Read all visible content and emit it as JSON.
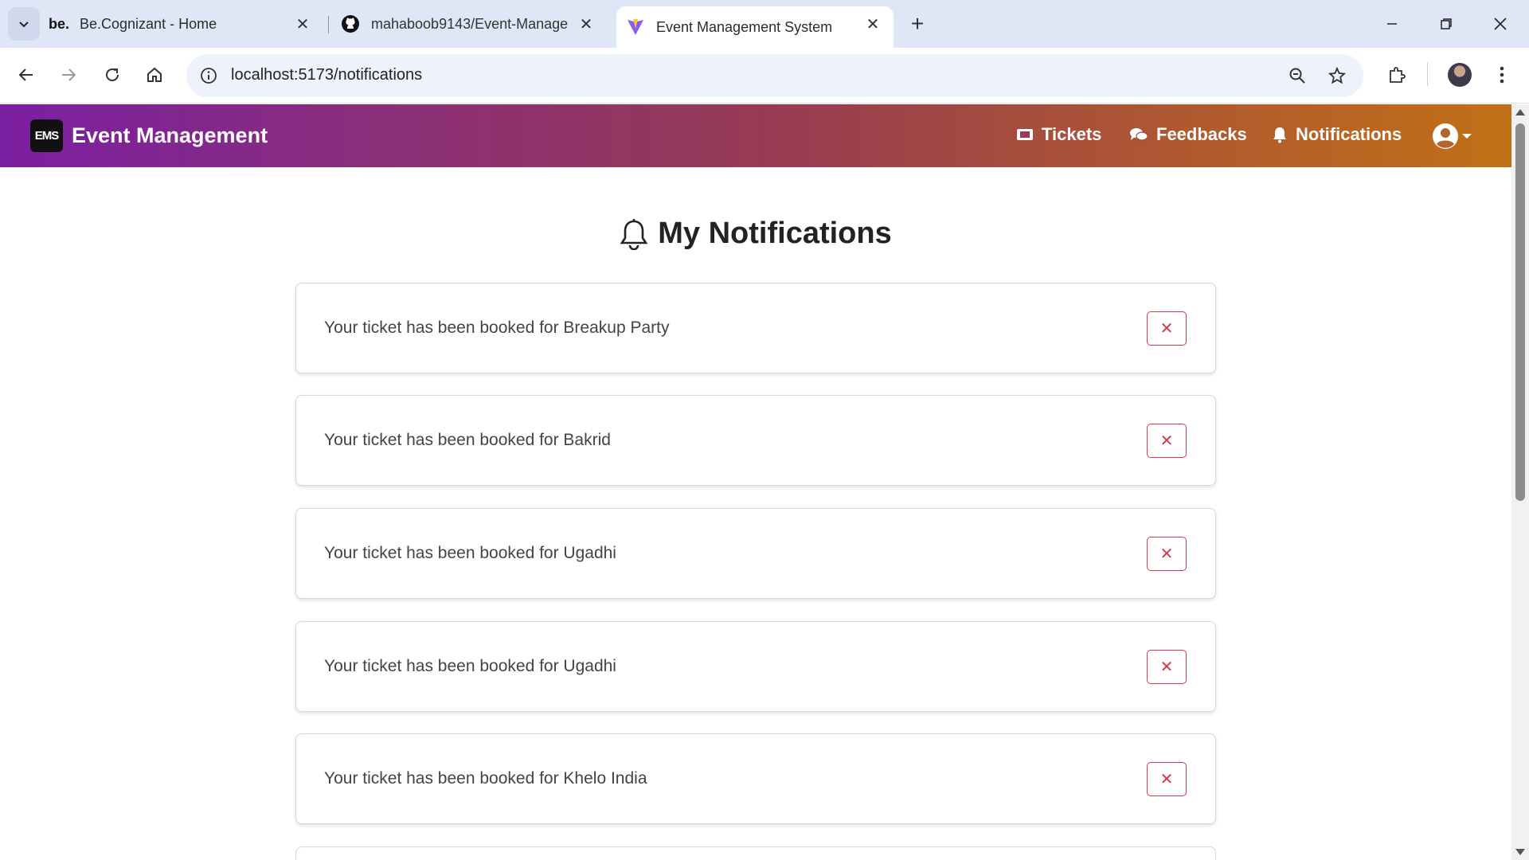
{
  "browser": {
    "tabs": [
      {
        "title": "Be.Cognizant - Home",
        "favicon": "be."
      },
      {
        "title": "mahaboob9143/Event-Manage",
        "favicon": "github-icon"
      },
      {
        "title": "Event Management System",
        "favicon": "vite-icon"
      }
    ],
    "url": "localhost:5173/notifications"
  },
  "app": {
    "brand_logo": "EMS",
    "brand_name": "Event Management",
    "nav": {
      "tickets": "Tickets",
      "feedbacks": "Feedbacks",
      "notifications": "Notifications"
    }
  },
  "page": {
    "title": "My Notifications"
  },
  "notifications": [
    {
      "message": "Your ticket has been booked for Breakup Party",
      "delete_label": "✕"
    },
    {
      "message": "Your ticket has been booked for Bakrid",
      "delete_label": "✕"
    },
    {
      "message": "Your ticket has been booked for Ugadhi",
      "delete_label": "✕"
    },
    {
      "message": "Your ticket has been booked for Ugadhi",
      "delete_label": "✕"
    },
    {
      "message": "Your ticket has been booked for Khelo India",
      "delete_label": "✕"
    }
  ],
  "colors": {
    "nav_gradient_start": "#7b1fa2",
    "nav_gradient_end": "#c27016",
    "delete_accent": "#d03a4a"
  }
}
